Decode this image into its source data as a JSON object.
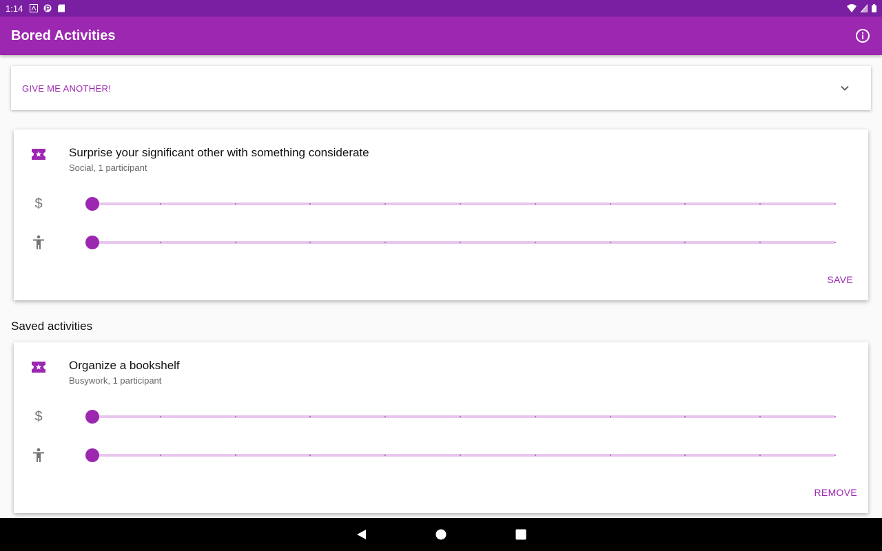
{
  "status_bar": {
    "time": "1:14"
  },
  "app_bar": {
    "title": "Bored Activities"
  },
  "expander": {
    "label": "GIVE ME ANOTHER!"
  },
  "current_activity": {
    "title": "Surprise your significant other with something considerate",
    "subtitle": "Social, 1 participant",
    "price_symbol": "$",
    "price_level": 0,
    "accessibility_level": 0,
    "action_label": "SAVE"
  },
  "saved_section": {
    "title": "Saved activities",
    "items": [
      {
        "title": "Organize a bookshelf",
        "subtitle": "Busywork, 1 participant",
        "price_symbol": "$",
        "price_level": 0,
        "accessibility_level": 0,
        "action_label": "REMOVE"
      }
    ]
  },
  "colors": {
    "primary": "#9c27b0",
    "primary_dark": "#7b1fa2",
    "track": "#e8c6ee"
  },
  "icons": {
    "info": "info-icon",
    "chevron": "chevron-down-icon",
    "ticket": "ticket-star-icon",
    "price": "dollar-icon",
    "accessibility": "accessibility-icon"
  }
}
